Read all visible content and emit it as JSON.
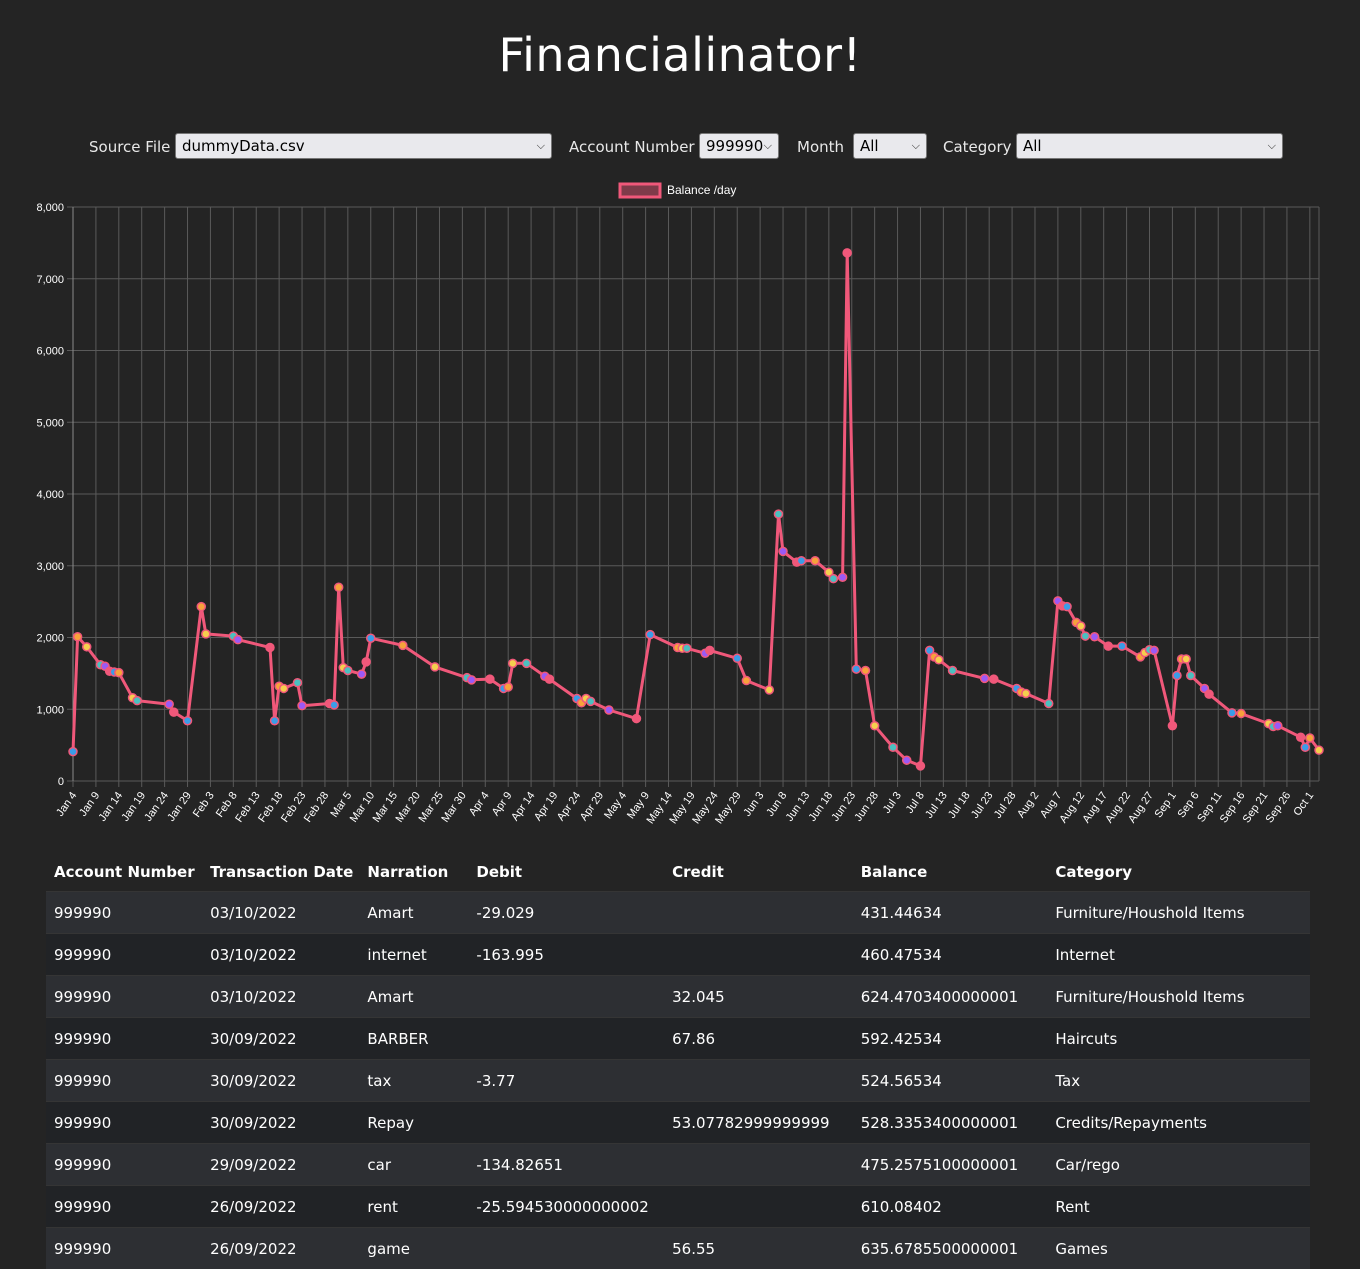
{
  "header": {
    "title": "Financialinator!"
  },
  "filters": {
    "source_file": {
      "label": "Source File",
      "value": "dummyData.csv"
    },
    "account_number": {
      "label": "Account Number",
      "value": "999990"
    },
    "month": {
      "label": "Month",
      "value": "All"
    },
    "category": {
      "label": "Category",
      "value": "All"
    }
  },
  "colors": {
    "line": "#f0587a",
    "point_palette": [
      "#3a9de8",
      "#f7a23b",
      "#f5cf4e",
      "#4bc0c0",
      "#9b59f6",
      "#f0587a"
    ]
  },
  "chart_data": {
    "type": "line",
    "legend": "Balance /day",
    "legend_position": "top-center",
    "grid": true,
    "ylim": [
      0,
      8000
    ],
    "yticks": [
      "0",
      "1,000",
      "2,000",
      "3,000",
      "4,000",
      "5,000",
      "6,000",
      "7,000",
      "8,000"
    ],
    "xlim": [
      "2022-01-04",
      "2022-10-03"
    ],
    "xticks": [
      "Jan 4",
      "Jan 9",
      "Jan 14",
      "Jan 19",
      "Jan 24",
      "Jan 29",
      "Feb 3",
      "Feb 8",
      "Feb 13",
      "Feb 18",
      "Feb 23",
      "Feb 28",
      "Mar 5",
      "Mar 10",
      "Mar 15",
      "Mar 20",
      "Mar 25",
      "Mar 30",
      "Apr 4",
      "Apr 9",
      "Apr 14",
      "Apr 19",
      "Apr 24",
      "Apr 29",
      "May 4",
      "May 9",
      "May 14",
      "May 19",
      "May 24",
      "May 29",
      "Jun 3",
      "Jun 8",
      "Jun 13",
      "Jun 18",
      "Jun 23",
      "Jun 28",
      "Jul 3",
      "Jul 8",
      "Jul 13",
      "Jul 18",
      "Jul 23",
      "Jul 28",
      "Aug 2",
      "Aug 7",
      "Aug 12",
      "Aug 17",
      "Aug 22",
      "Aug 27",
      "Sep 1",
      "Sep 6",
      "Sep 11",
      "Sep 16",
      "Sep 21",
      "Sep 26",
      "Oct 1"
    ],
    "series": [
      {
        "name": "Balance /day",
        "points": [
          [
            "2022-01-04",
            410
          ],
          [
            "2022-01-05",
            2010
          ],
          [
            "2022-01-07",
            1870
          ],
          [
            "2022-01-10",
            1620
          ],
          [
            "2022-01-11",
            1600
          ],
          [
            "2022-01-12",
            1530
          ],
          [
            "2022-01-13",
            1520
          ],
          [
            "2022-01-14",
            1510
          ],
          [
            "2022-01-17",
            1160
          ],
          [
            "2022-01-18",
            1120
          ],
          [
            "2022-01-25",
            1070
          ],
          [
            "2022-01-26",
            960
          ],
          [
            "2022-01-29",
            840
          ],
          [
            "2022-02-01",
            2430
          ],
          [
            "2022-02-02",
            2050
          ],
          [
            "2022-02-08",
            2020
          ],
          [
            "2022-02-09",
            1970
          ],
          [
            "2022-02-16",
            1860
          ],
          [
            "2022-02-17",
            840
          ],
          [
            "2022-02-18",
            1320
          ],
          [
            "2022-02-19",
            1290
          ],
          [
            "2022-02-22",
            1370
          ],
          [
            "2022-02-23",
            1050
          ],
          [
            "2022-03-01",
            1080
          ],
          [
            "2022-03-02",
            1060
          ],
          [
            "2022-03-03",
            2700
          ],
          [
            "2022-03-04",
            1580
          ],
          [
            "2022-03-05",
            1540
          ],
          [
            "2022-03-08",
            1490
          ],
          [
            "2022-03-09",
            1660
          ],
          [
            "2022-03-10",
            1990
          ],
          [
            "2022-03-17",
            1890
          ],
          [
            "2022-03-24",
            1590
          ],
          [
            "2022-03-31",
            1440
          ],
          [
            "2022-04-01",
            1410
          ],
          [
            "2022-04-05",
            1420
          ],
          [
            "2022-04-08",
            1290
          ],
          [
            "2022-04-09",
            1310
          ],
          [
            "2022-04-10",
            1640
          ],
          [
            "2022-04-13",
            1640
          ],
          [
            "2022-04-17",
            1460
          ],
          [
            "2022-04-18",
            1420
          ],
          [
            "2022-04-24",
            1150
          ],
          [
            "2022-04-25",
            1090
          ],
          [
            "2022-04-26",
            1150
          ],
          [
            "2022-04-27",
            1110
          ],
          [
            "2022-05-01",
            990
          ],
          [
            "2022-05-07",
            870
          ],
          [
            "2022-05-10",
            2040
          ],
          [
            "2022-05-16",
            1860
          ],
          [
            "2022-05-17",
            1850
          ],
          [
            "2022-05-18",
            1850
          ],
          [
            "2022-05-22",
            1780
          ],
          [
            "2022-05-23",
            1820
          ],
          [
            "2022-05-29",
            1710
          ],
          [
            "2022-05-31",
            1400
          ],
          [
            "2022-06-05",
            1270
          ],
          [
            "2022-06-07",
            3720
          ],
          [
            "2022-06-08",
            3200
          ],
          [
            "2022-06-11",
            3050
          ],
          [
            "2022-06-12",
            3070
          ],
          [
            "2022-06-15",
            3070
          ],
          [
            "2022-06-18",
            2910
          ],
          [
            "2022-06-19",
            2820
          ],
          [
            "2022-06-21",
            2840
          ],
          [
            "2022-06-22",
            7360
          ],
          [
            "2022-06-24",
            1560
          ],
          [
            "2022-06-26",
            1540
          ],
          [
            "2022-06-28",
            770
          ],
          [
            "2022-07-02",
            470
          ],
          [
            "2022-07-05",
            290
          ],
          [
            "2022-07-08",
            210
          ],
          [
            "2022-07-10",
            1820
          ],
          [
            "2022-07-11",
            1730
          ],
          [
            "2022-07-12",
            1690
          ],
          [
            "2022-07-15",
            1540
          ],
          [
            "2022-07-22",
            1430
          ],
          [
            "2022-07-24",
            1420
          ],
          [
            "2022-07-29",
            1290
          ],
          [
            "2022-07-30",
            1240
          ],
          [
            "2022-07-31",
            1220
          ],
          [
            "2022-08-05",
            1080
          ],
          [
            "2022-08-07",
            2510
          ],
          [
            "2022-08-08",
            2440
          ],
          [
            "2022-08-09",
            2430
          ],
          [
            "2022-08-11",
            2210
          ],
          [
            "2022-08-12",
            2160
          ],
          [
            "2022-08-13",
            2020
          ],
          [
            "2022-08-15",
            2010
          ],
          [
            "2022-08-18",
            1880
          ],
          [
            "2022-08-21",
            1880
          ],
          [
            "2022-08-25",
            1730
          ],
          [
            "2022-08-26",
            1790
          ],
          [
            "2022-08-27",
            1830
          ],
          [
            "2022-08-28",
            1820
          ],
          [
            "2022-09-01",
            770
          ],
          [
            "2022-09-02",
            1470
          ],
          [
            "2022-09-03",
            1700
          ],
          [
            "2022-09-04",
            1700
          ],
          [
            "2022-09-05",
            1470
          ],
          [
            "2022-09-08",
            1290
          ],
          [
            "2022-09-09",
            1210
          ],
          [
            "2022-09-14",
            950
          ],
          [
            "2022-09-16",
            940
          ],
          [
            "2022-09-22",
            800
          ],
          [
            "2022-09-23",
            760
          ],
          [
            "2022-09-24",
            770
          ],
          [
            "2022-09-29",
            610
          ],
          [
            "2022-09-30",
            470
          ],
          [
            "2022-10-01",
            600
          ],
          [
            "2022-10-03",
            430
          ]
        ]
      }
    ]
  },
  "table": {
    "columns": [
      "Account Number",
      "Transaction Date",
      "Narration",
      "Debit",
      "Credit",
      "Balance",
      "Category"
    ],
    "rows": [
      [
        "999990",
        "03/10/2022",
        "Amart",
        "-29.029",
        "",
        "431.44634",
        "Furniture/Houshold Items"
      ],
      [
        "999990",
        "03/10/2022",
        "internet",
        "-163.995",
        "",
        "460.47534",
        "Internet"
      ],
      [
        "999990",
        "03/10/2022",
        "Amart",
        "",
        "32.045",
        "624.4703400000001",
        "Furniture/Houshold Items"
      ],
      [
        "999990",
        "30/09/2022",
        "BARBER",
        "",
        "67.86",
        "592.42534",
        "Haircuts"
      ],
      [
        "999990",
        "30/09/2022",
        "tax",
        "-3.77",
        "",
        "524.56534",
        "Tax"
      ],
      [
        "999990",
        "30/09/2022",
        "Repay",
        "",
        "53.07782999999999",
        "528.3353400000001",
        "Credits/Repayments"
      ],
      [
        "999990",
        "29/09/2022",
        "car",
        "-134.82651",
        "",
        "475.2575100000001",
        "Car/rego"
      ],
      [
        "999990",
        "26/09/2022",
        "rent",
        "-25.594530000000002",
        "",
        "610.08402",
        "Rent"
      ],
      [
        "999990",
        "26/09/2022",
        "game",
        "",
        "56.55",
        "635.6785500000001",
        "Games"
      ]
    ]
  }
}
